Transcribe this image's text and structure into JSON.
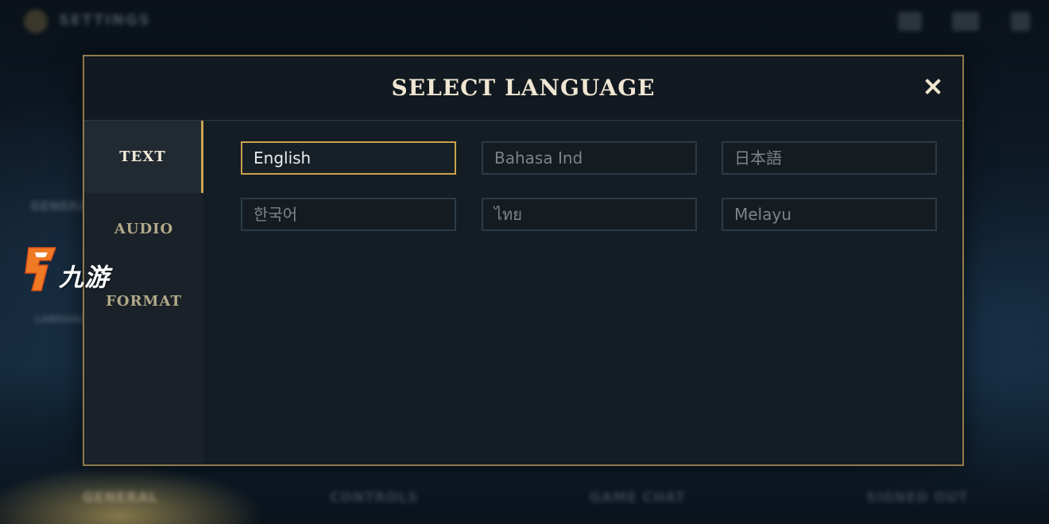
{
  "modal": {
    "title": "SELECT LANGUAGE",
    "close_icon": "close-icon"
  },
  "sidebar": {
    "tabs": [
      {
        "label": "TEXT",
        "active": true
      },
      {
        "label": "AUDIO",
        "active": false
      },
      {
        "label": "FORMAT",
        "active": false
      }
    ]
  },
  "languages": [
    {
      "label": "English",
      "selected": true
    },
    {
      "label": "Bahasa Ind",
      "selected": false
    },
    {
      "label": "日本語",
      "selected": false
    },
    {
      "label": "한국어",
      "selected": false
    },
    {
      "label": "ไทย",
      "selected": false
    },
    {
      "label": "Melayu",
      "selected": false
    }
  ],
  "watermark": {
    "text": "九游"
  },
  "colors": {
    "accent_gold": "#c9a24c",
    "modal_border": "#8f7a4b",
    "title_text": "#efe6d2"
  }
}
